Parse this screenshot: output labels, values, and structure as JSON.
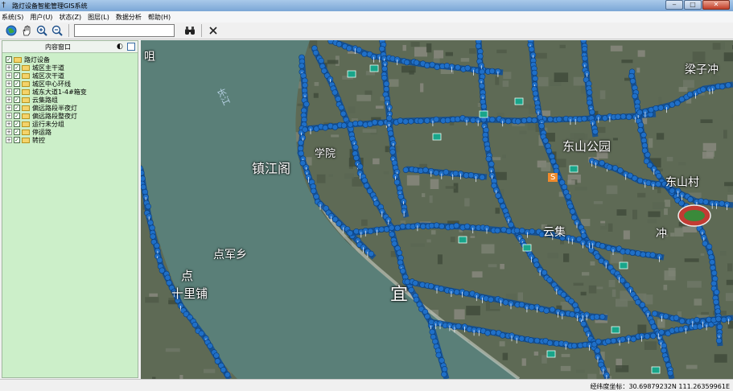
{
  "window": {
    "title": "路灯设备智能管理GIS系统",
    "app_icon": "lamp-icon"
  },
  "menu": [
    "系统(S)",
    "用户(U)",
    "状态(Z)",
    "图层(L)",
    "数据分析",
    "帮助(H)"
  ],
  "toolbar": {
    "search_value": "",
    "tools": [
      "globe-icon",
      "pan-hand-icon",
      "zoom-in-icon",
      "zoom-out-icon",
      "binoculars-icon",
      "close-x-icon"
    ]
  },
  "panel": {
    "title": "内容窗口",
    "tree": {
      "root": "路灯设备",
      "children": [
        "城区主干道",
        "城区次干道",
        "城区中心环线",
        "城东大道1-4#箱变",
        "云集路组",
        "偏远路段半夜灯",
        "偏远路段整夜灯",
        "运行未分组",
        "停运路",
        "转控"
      ]
    }
  },
  "map": {
    "labels": {
      "river": "长江",
      "zhenjiangge": "镇江阁",
      "dongshan_park": "东山公园",
      "liangzichong": "梁子冲",
      "dongshancun": "东山村",
      "dianjunxiang": "点军乡",
      "shilipu": "十里铺",
      "yi": "宜",
      "yunji": "云集",
      "xuan": "学院",
      "dian": "点",
      "chong": "冲",
      "road": "S",
      "ju": "咀"
    },
    "colors": {
      "marker": "#1f6fc7",
      "road": "#0d4e9a",
      "station": "#19a58a",
      "water": "#5a7f78"
    }
  },
  "status": {
    "label": "经纬度坐标：",
    "value": "30.69879232N 111.26359961E"
  }
}
